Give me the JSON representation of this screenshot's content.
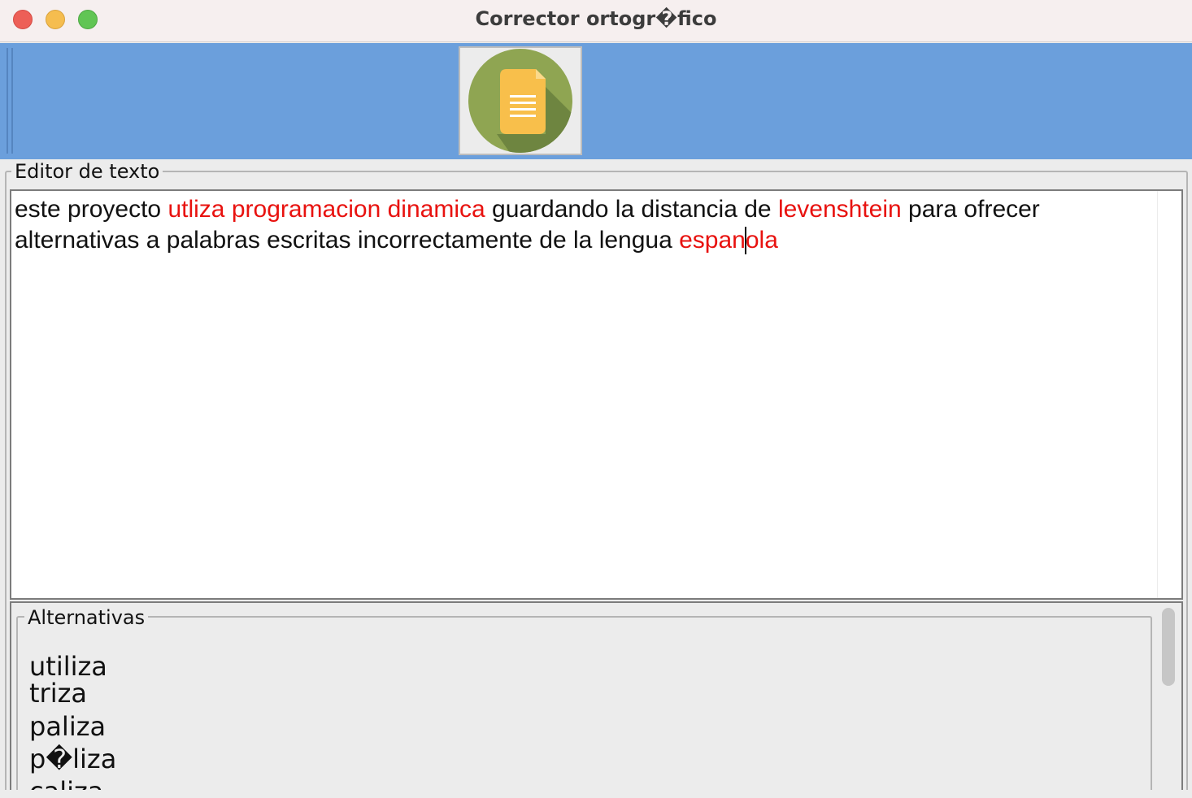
{
  "window": {
    "title": "Corrector ortogr�fico"
  },
  "toolbar": {
    "button_icon": "document-icon"
  },
  "editor": {
    "legend": "Editor de texto",
    "lines": [
      [
        {
          "text": "este proyecto ",
          "error": false
        },
        {
          "text": "utliza",
          "error": true
        },
        {
          "text": " ",
          "error": false
        },
        {
          "text": "programacion",
          "error": true
        },
        {
          "text": " ",
          "error": false
        },
        {
          "text": "dinamica",
          "error": true
        },
        {
          "text": " guardando la distancia de ",
          "error": false
        },
        {
          "text": "levenshtein",
          "error": true
        },
        {
          "text": " para ofrecer",
          "error": false
        }
      ],
      [
        {
          "text": "alternativas a palabras escritas incorrectamente de la lengua ",
          "error": false
        },
        {
          "text": "espan",
          "error": true,
          "caret_after": true
        },
        {
          "text": "ola",
          "error": true
        }
      ]
    ],
    "error_color": "#e8120f"
  },
  "alternatives": {
    "legend": "Alternativas",
    "items": [
      "utiliza",
      "triza",
      "paliza",
      "p�liza",
      "caliza"
    ]
  }
}
